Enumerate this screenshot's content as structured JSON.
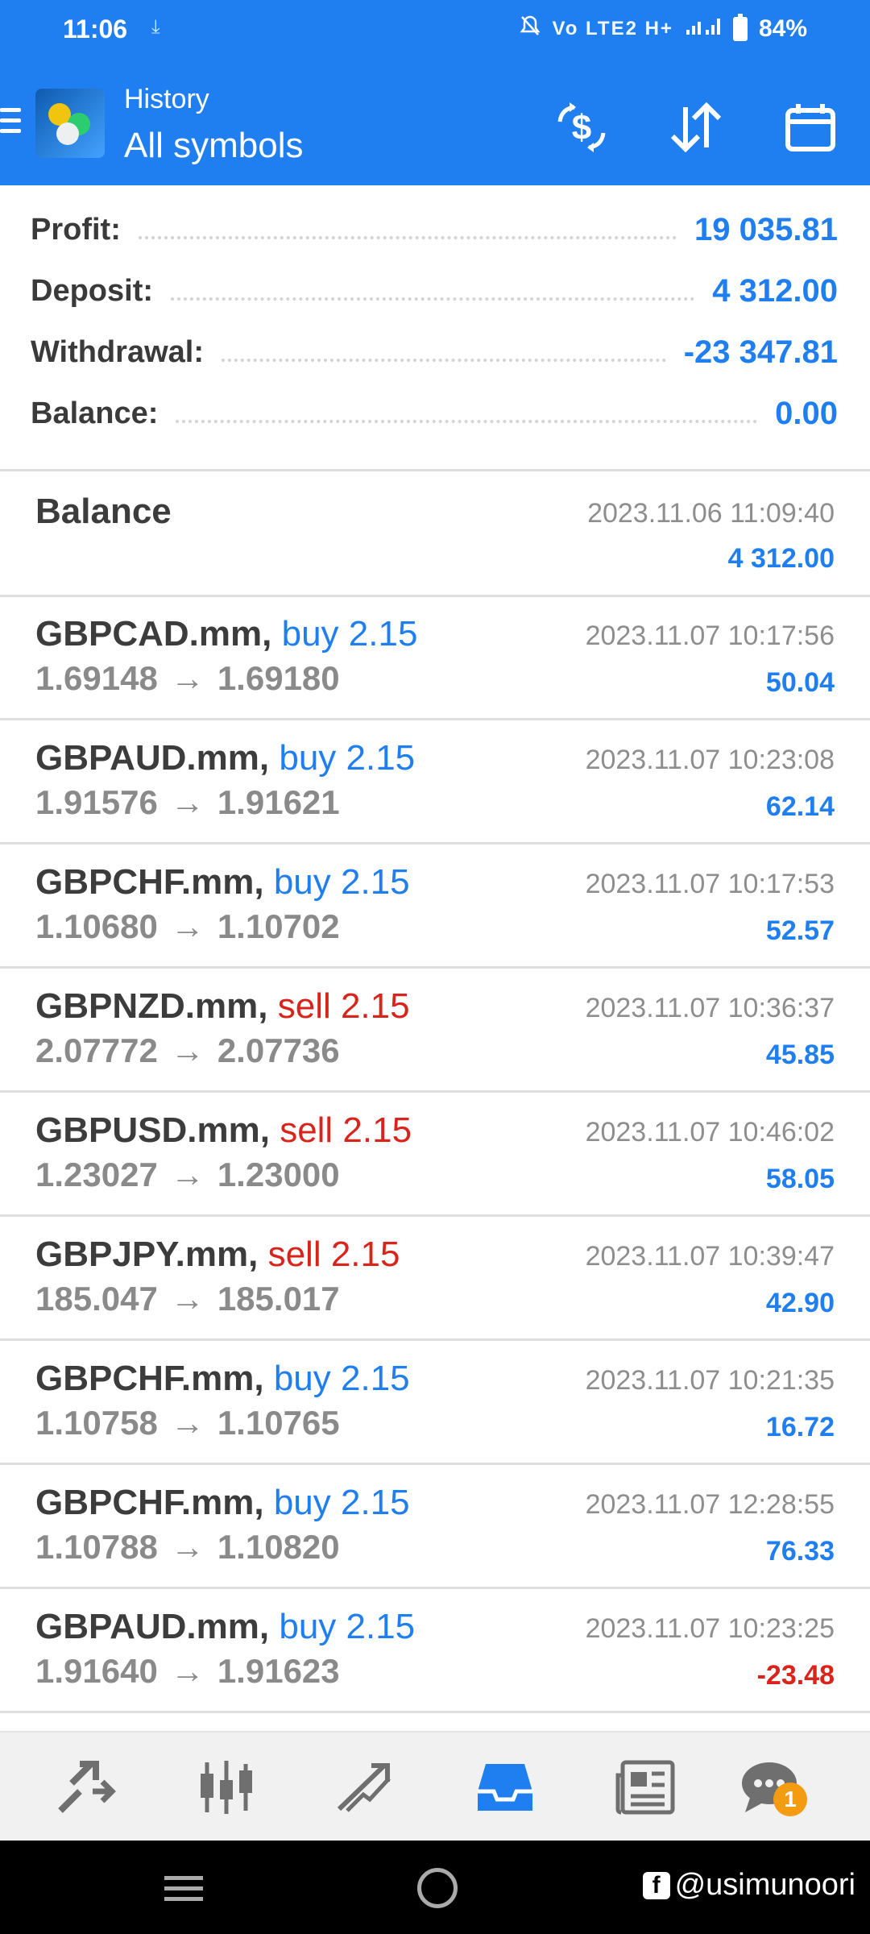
{
  "status_bar": {
    "time": "11:06",
    "network": "Vo LTE2 H+",
    "battery": "84%"
  },
  "header": {
    "title": "History",
    "subtitle": "All symbols"
  },
  "summary": {
    "profit_label": "Profit:",
    "profit": "19 035.81",
    "deposit_label": "Deposit:",
    "deposit": "4 312.00",
    "withdrawal_label": "Withdrawal:",
    "withdrawal": "-23 347.81",
    "balance_label": "Balance:",
    "balance": "0.00"
  },
  "balance_entry": {
    "title": "Balance",
    "time": "2023.11.06 11:09:40",
    "amount": "4 312.00"
  },
  "trades": [
    {
      "symbol": "GBPCAD.mm,",
      "side": "buy 2.15",
      "side_type": "buy",
      "open": "1.69148",
      "close": "1.69180",
      "time": "2023.11.07 10:17:56",
      "profit": "50.04",
      "profit_sign": "pos"
    },
    {
      "symbol": "GBPAUD.mm,",
      "side": "buy 2.15",
      "side_type": "buy",
      "open": "1.91576",
      "close": "1.91621",
      "time": "2023.11.07 10:23:08",
      "profit": "62.14",
      "profit_sign": "pos"
    },
    {
      "symbol": "GBPCHF.mm,",
      "side": "buy 2.15",
      "side_type": "buy",
      "open": "1.10680",
      "close": "1.10702",
      "time": "2023.11.07 10:17:53",
      "profit": "52.57",
      "profit_sign": "pos"
    },
    {
      "symbol": "GBPNZD.mm,",
      "side": "sell 2.15",
      "side_type": "sell",
      "open": "2.07772",
      "close": "2.07736",
      "time": "2023.11.07 10:36:37",
      "profit": "45.85",
      "profit_sign": "pos"
    },
    {
      "symbol": "GBPUSD.mm,",
      "side": "sell 2.15",
      "side_type": "sell",
      "open": "1.23027",
      "close": "1.23000",
      "time": "2023.11.07 10:46:02",
      "profit": "58.05",
      "profit_sign": "pos"
    },
    {
      "symbol": "GBPJPY.mm,",
      "side": "sell 2.15",
      "side_type": "sell",
      "open": "185.047",
      "close": "185.017",
      "time": "2023.11.07 10:39:47",
      "profit": "42.90",
      "profit_sign": "pos"
    },
    {
      "symbol": "GBPCHF.mm,",
      "side": "buy 2.15",
      "side_type": "buy",
      "open": "1.10758",
      "close": "1.10765",
      "time": "2023.11.07 10:21:35",
      "profit": "16.72",
      "profit_sign": "pos"
    },
    {
      "symbol": "GBPCHF.mm,",
      "side": "buy 2.15",
      "side_type": "buy",
      "open": "1.10788",
      "close": "1.10820",
      "time": "2023.11.07 12:28:55",
      "profit": "76.33",
      "profit_sign": "pos"
    },
    {
      "symbol": "GBPAUD.mm,",
      "side": "buy 2.15",
      "side_type": "buy",
      "open": "1.91640",
      "close": "1.91623",
      "time": "2023.11.07 10:23:25",
      "profit": "-23.48",
      "profit_sign": "neg"
    }
  ],
  "arrow": "→",
  "bottom_nav": {
    "items": [
      {
        "icon": "trade-icon"
      },
      {
        "icon": "quotes-icon"
      },
      {
        "icon": "chart-icon"
      },
      {
        "icon": "history-icon",
        "active": true
      },
      {
        "icon": "news-icon"
      },
      {
        "icon": "chat-icon"
      }
    ],
    "chat_badge": "1"
  },
  "watermark": "@usimunoori",
  "colors": {
    "accent": "#1f7ef0",
    "sell": "#d9241c",
    "muted": "#8e8e8e"
  }
}
